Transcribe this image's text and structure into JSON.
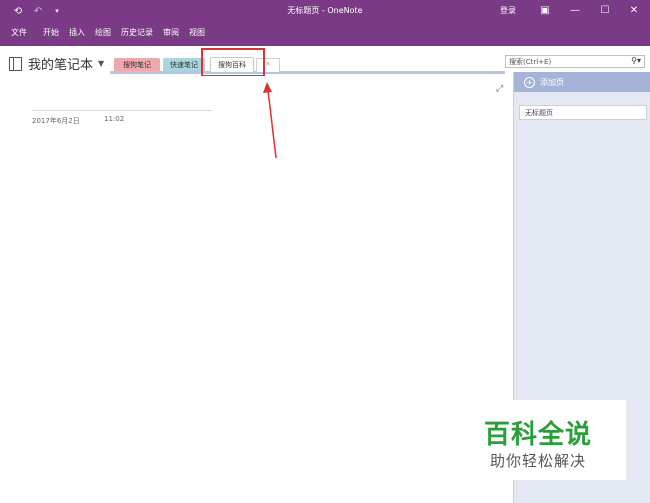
{
  "titlebar": {
    "title": "无标题页 - OneNote",
    "login": "登录",
    "back_icon": "back-circle-icon",
    "undo_icon": "undo-icon",
    "qa_icon": "quick-access-dropdown-icon"
  },
  "window_controls": {
    "ribbon_display": "▣",
    "minimize": "—",
    "maximize": "☐",
    "close": "✕"
  },
  "menu": {
    "items": [
      "文件",
      "开始",
      "插入",
      "绘图",
      "历史记录",
      "审阅",
      "视图"
    ]
  },
  "notebook": {
    "name": "我的笔记本",
    "caret": "▼"
  },
  "sections": {
    "tabs": [
      {
        "label": "搜狗笔记",
        "color": "#f1a7ae"
      },
      {
        "label": "快速笔记",
        "color": "#a9d6dd"
      },
      {
        "label": "搜狗百科",
        "color": "#ffffff"
      }
    ],
    "add_tab": "*"
  },
  "search": {
    "placeholder": "搜索(Ctrl+E)",
    "icon": "⚲▾"
  },
  "page": {
    "date": "2017年6月2日",
    "time": "11:02",
    "expand_icon": "⤢"
  },
  "pages_panel": {
    "add_page_label": "添加页",
    "plus": "+",
    "items": [
      "无标题页"
    ]
  },
  "watermark": {
    "main": "百科全说",
    "sub": "助你轻松解决"
  },
  "colors": {
    "titlebar": "#7b3a85",
    "highlight": "#d93333",
    "watermark_green": "#2b9e3c"
  }
}
